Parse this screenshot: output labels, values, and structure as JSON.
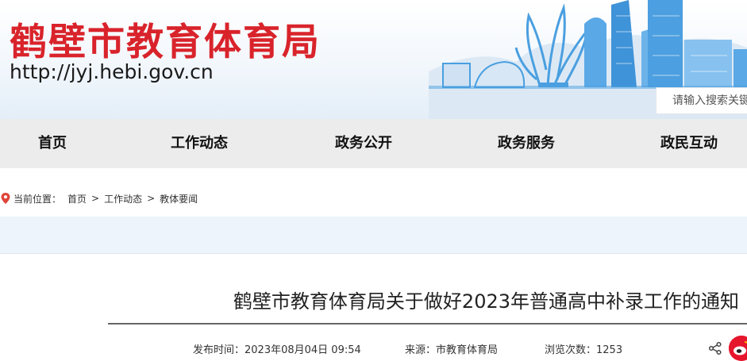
{
  "header": {
    "site_title": "鹤壁市教育体育局",
    "site_url": "http://jyj.hebi.gov.cn",
    "search_placeholder": "请输入搜索关键字"
  },
  "nav": {
    "items": [
      {
        "label": "首页"
      },
      {
        "label": "工作动态"
      },
      {
        "label": "政务公开"
      },
      {
        "label": "政务服务"
      },
      {
        "label": "政民互动"
      }
    ]
  },
  "breadcrumb": {
    "prefix": "当前位置：",
    "items": [
      "首页",
      "工作动态",
      "教体要闻"
    ],
    "separator": ">"
  },
  "article": {
    "title": "鹤壁市教育体育局关于做好2023年普通高中补录工作的通知",
    "published": "发布时间：2023年08月04日 09:54",
    "source": "来源：市教育体育局",
    "views": "浏览次数：1253"
  },
  "colors": {
    "brand_red": "#d9232b",
    "skyline_blue": "#4a9fe0",
    "nav_bg": "#ececec",
    "weibo_red": "#e6162d"
  },
  "icons": {
    "breadcrumb": "location-pin-icon",
    "share": "share-icon",
    "social": "weibo-icon"
  }
}
